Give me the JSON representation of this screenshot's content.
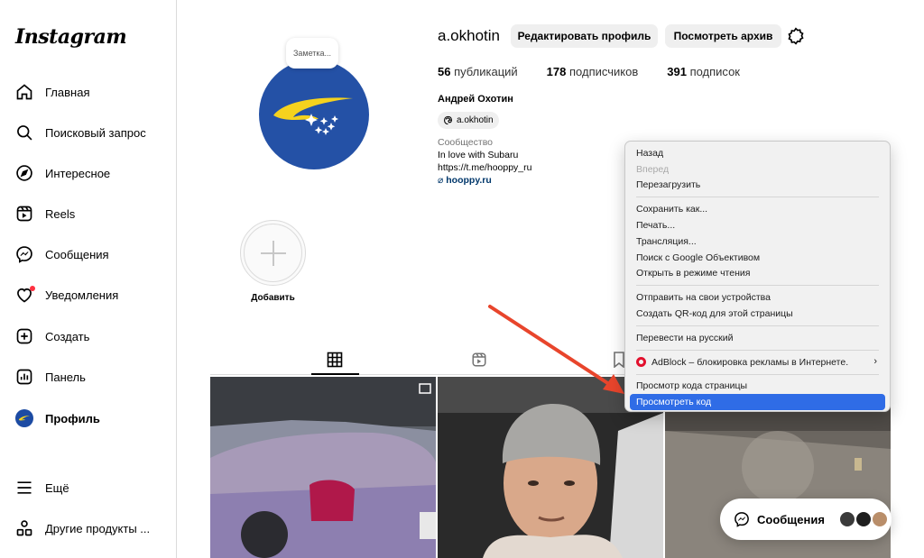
{
  "sidebar": {
    "logo": "Instagram",
    "items": [
      {
        "label": "Главная",
        "icon": "home-icon"
      },
      {
        "label": "Поисковый запрос",
        "icon": "search-icon"
      },
      {
        "label": "Интересное",
        "icon": "compass-icon"
      },
      {
        "label": "Reels",
        "icon": "reels-icon"
      },
      {
        "label": "Сообщения",
        "icon": "messenger-icon"
      },
      {
        "label": "Уведомления",
        "icon": "heart-icon"
      },
      {
        "label": "Создать",
        "icon": "plus-square-icon"
      },
      {
        "label": "Панель",
        "icon": "dashboard-icon"
      },
      {
        "label": "Профиль",
        "icon": "avatar-icon"
      },
      {
        "label": "Ещё",
        "icon": "menu-icon"
      },
      {
        "label": "Другие продукты ...",
        "icon": "products-icon"
      }
    ]
  },
  "profile": {
    "note": "Заметка...",
    "username": "a.okhotin",
    "edit_button": "Редактировать профиль",
    "archive_button": "Посмотреть архив",
    "stats": {
      "posts_count": "56",
      "posts_label": "публикаций",
      "followers_count": "178",
      "followers_label": "подписчиков",
      "following_count": "391",
      "following_label": "подписок"
    },
    "full_name": "Андрей Охотин",
    "threads_handle": "a.okhotin",
    "category": "Сообщество",
    "bio_line1": "In love with Subaru",
    "bio_line2": "https://t.me/hooppy_ru",
    "website": "hooppy.ru"
  },
  "highlights": {
    "add_label": "Добавить"
  },
  "context_menu": {
    "group1": [
      "Назад",
      "Вперед",
      "Перезагрузить"
    ],
    "group2": [
      "Сохранить как...",
      "Печать...",
      "Трансляция...",
      "Поиск с Google Объективом",
      "Открыть в режиме чтения"
    ],
    "group3": [
      "Отправить на свои устройства",
      "Создать QR-код для этой страницы"
    ],
    "group4": [
      "Перевести на русский"
    ],
    "group5": [
      "AdBlock – блокировка рекламы в Интернете."
    ],
    "group6": [
      "Просмотр кода страницы",
      "Просмотреть код"
    ]
  },
  "messages_pill": {
    "label": "Сообщения"
  },
  "colors": {
    "accent_blue": "#2f6ce6",
    "avatar_blue": "#2451a6",
    "subaru_yellow": "#f5d21e",
    "arrow_red": "#e8452c",
    "notification_red": "#ff3040"
  }
}
